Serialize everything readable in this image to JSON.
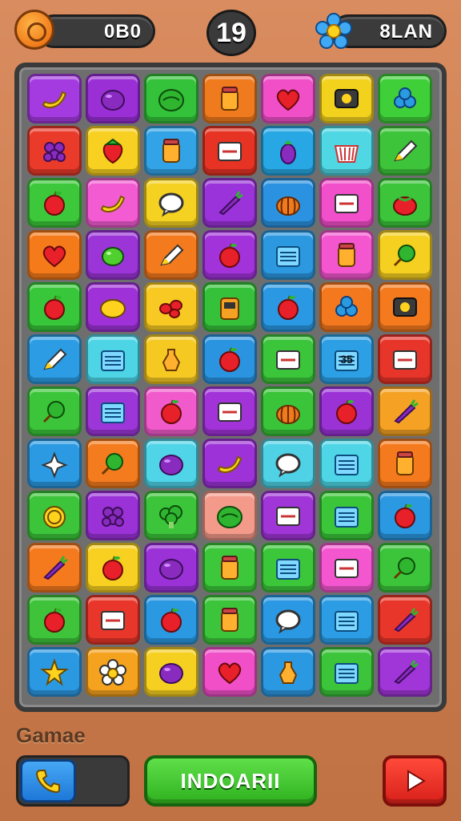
{
  "hud": {
    "coins_value": "0B0",
    "level_number": "19",
    "gems_value": "8LAN",
    "coin_icon": "coin-icon",
    "gem_icon": "flower-icon"
  },
  "board": {
    "columns": 7,
    "rows": 12,
    "tiles": [
      {
        "color": "#a43be0",
        "icon": "banana",
        "text": ""
      },
      {
        "color": "#9a2fd6",
        "icon": "plum",
        "text": ""
      },
      {
        "color": "#34c23a",
        "icon": "melon",
        "text": ""
      },
      {
        "color": "#f07a1e",
        "icon": "jar",
        "text": ""
      },
      {
        "color": "#f04fc8",
        "icon": "heart",
        "text": ""
      },
      {
        "color": "#f3d21e",
        "icon": "tv",
        "text": ""
      },
      {
        "color": "#3fcf39",
        "icon": "berries",
        "text": ""
      },
      {
        "color": "#ea3a2a",
        "icon": "grapes",
        "text": ""
      },
      {
        "color": "#f7d021",
        "icon": "strawberry",
        "text": ""
      },
      {
        "color": "#32a3e6",
        "icon": "jar",
        "text": ""
      },
      {
        "color": "#e63324",
        "icon": "card",
        "text": ""
      },
      {
        "color": "#27a7e3",
        "icon": "eggplant",
        "text": ""
      },
      {
        "color": "#4fd7e4",
        "icon": "basket",
        "text": ""
      },
      {
        "color": "#3ec43a",
        "icon": "pencil",
        "text": ""
      },
      {
        "color": "#3cc83a",
        "icon": "apple",
        "text": ""
      },
      {
        "color": "#f35bd2",
        "icon": "banana",
        "text": ""
      },
      {
        "color": "#f5d222",
        "icon": "bubble",
        "text": ""
      },
      {
        "color": "#9a33d9",
        "icon": "carrot",
        "text": ""
      },
      {
        "color": "#2a92e0",
        "icon": "pumpkin",
        "text": ""
      },
      {
        "color": "#f24fca",
        "icon": "card",
        "text": ""
      },
      {
        "color": "#3cc43a",
        "icon": "tomato",
        "text": ""
      },
      {
        "color": "#f57a1a",
        "icon": "heart",
        "text": ""
      },
      {
        "color": "#9b35d8",
        "icon": "lime",
        "text": ""
      },
      {
        "color": "#f47a1e",
        "icon": "pencil",
        "text": ""
      },
      {
        "color": "#a233db",
        "icon": "apple",
        "text": ""
      },
      {
        "color": "#2b98e0",
        "icon": "box",
        "text": ""
      },
      {
        "color": "#f356cf",
        "icon": "jar",
        "text": ""
      },
      {
        "color": "#f6d021",
        "icon": "lollipop",
        "text": ""
      },
      {
        "color": "#38c63a",
        "icon": "apple",
        "text": ""
      },
      {
        "color": "#9e32d8",
        "icon": "lemon",
        "text": ""
      },
      {
        "color": "#f7c922",
        "icon": "beans",
        "text": ""
      },
      {
        "color": "#35c23a",
        "icon": "radio",
        "text": ""
      },
      {
        "color": "#2a98e2",
        "icon": "apple",
        "text": ""
      },
      {
        "color": "#f4781e",
        "icon": "berries",
        "text": ""
      },
      {
        "color": "#f57a1e",
        "icon": "tv",
        "text": ""
      },
      {
        "color": "#2c9de4",
        "icon": "pencil",
        "text": ""
      },
      {
        "color": "#4dd5e6",
        "icon": "box",
        "text": ""
      },
      {
        "color": "#f6c922",
        "icon": "bottle",
        "text": ""
      },
      {
        "color": "#2b94e0",
        "icon": "apple",
        "text": ""
      },
      {
        "color": "#3bc53a",
        "icon": "card",
        "text": ""
      },
      {
        "color": "#2d9fe4",
        "icon": "box",
        "text": "35"
      },
      {
        "color": "#e8352a",
        "icon": "card",
        "text": ""
      },
      {
        "color": "#3cc53a",
        "icon": "lollipop",
        "text": ""
      },
      {
        "color": "#9c36d8",
        "icon": "box",
        "text": ""
      },
      {
        "color": "#f05acb",
        "icon": "apple",
        "text": ""
      },
      {
        "color": "#a133d9",
        "icon": "card",
        "text": ""
      },
      {
        "color": "#3ac43a",
        "icon": "pumpkin",
        "text": ""
      },
      {
        "color": "#9a32d6",
        "icon": "apple",
        "text": ""
      },
      {
        "color": "#f5a224",
        "icon": "carrot",
        "text": ""
      },
      {
        "color": "#2b9ae3",
        "icon": "star4",
        "text": ""
      },
      {
        "color": "#f47b1e",
        "icon": "lollipop",
        "text": ""
      },
      {
        "color": "#4fd4e8",
        "icon": "plum",
        "text": ""
      },
      {
        "color": "#9c32d8",
        "icon": "banana",
        "text": ""
      },
      {
        "color": "#4fd2e6",
        "icon": "bubble",
        "text": ""
      },
      {
        "color": "#4fd6e6",
        "icon": "box",
        "text": ""
      },
      {
        "color": "#f57a1e",
        "icon": "jar",
        "text": ""
      },
      {
        "color": "#3cc43a",
        "icon": "coin",
        "text": ""
      },
      {
        "color": "#9a32d8",
        "icon": "grapes",
        "text": ""
      },
      {
        "color": "#3cc43a",
        "icon": "broccoli",
        "text": ""
      },
      {
        "color": "#f39a8a",
        "icon": "melon",
        "text": ""
      },
      {
        "color": "#a035d8",
        "icon": "card",
        "text": ""
      },
      {
        "color": "#3bc63a",
        "icon": "box",
        "text": ""
      },
      {
        "color": "#2b98e2",
        "icon": "apple",
        "text": ""
      },
      {
        "color": "#f57a1e",
        "icon": "carrot",
        "text": ""
      },
      {
        "color": "#f7d021",
        "icon": "apple",
        "text": ""
      },
      {
        "color": "#9a32d8",
        "icon": "plum",
        "text": ""
      },
      {
        "color": "#3cc83a",
        "icon": "jar",
        "text": ""
      },
      {
        "color": "#3cc63a",
        "icon": "box",
        "text": ""
      },
      {
        "color": "#f356cf",
        "icon": "card",
        "text": ""
      },
      {
        "color": "#3cc43a",
        "icon": "lollipop",
        "text": ""
      },
      {
        "color": "#3ec33a",
        "icon": "apple",
        "text": ""
      },
      {
        "color": "#e8362a",
        "icon": "card",
        "text": ""
      },
      {
        "color": "#2b98e2",
        "icon": "apple",
        "text": ""
      },
      {
        "color": "#3cc53a",
        "icon": "jar",
        "text": ""
      },
      {
        "color": "#2a98e2",
        "icon": "bubble",
        "text": ""
      },
      {
        "color": "#2c9de4",
        "icon": "box",
        "text": ""
      },
      {
        "color": "#e8362a",
        "icon": "carrot",
        "text": ""
      },
      {
        "color": "#2b98e2",
        "icon": "star",
        "text": ""
      },
      {
        "color": "#f5a21e",
        "icon": "flower",
        "text": ""
      },
      {
        "color": "#f6d021",
        "icon": "plum",
        "text": ""
      },
      {
        "color": "#f04fc8",
        "icon": "heart",
        "text": ""
      },
      {
        "color": "#2b98e2",
        "icon": "bottle",
        "text": ""
      },
      {
        "color": "#3cc43a",
        "icon": "box",
        "text": ""
      },
      {
        "color": "#a035d8",
        "icon": "carrot",
        "text": ""
      }
    ]
  },
  "footer": {
    "game_label": "Gamae",
    "main_button_label": "INDOARII",
    "call_icon": "phone-icon",
    "play_icon": "play-icon"
  },
  "colors": {
    "background": "#c97a4c",
    "board_frame": "#3a3a3a",
    "main_button": "#3cc43a",
    "play_button": "#e8362a",
    "call_button": "#2b88e0"
  }
}
